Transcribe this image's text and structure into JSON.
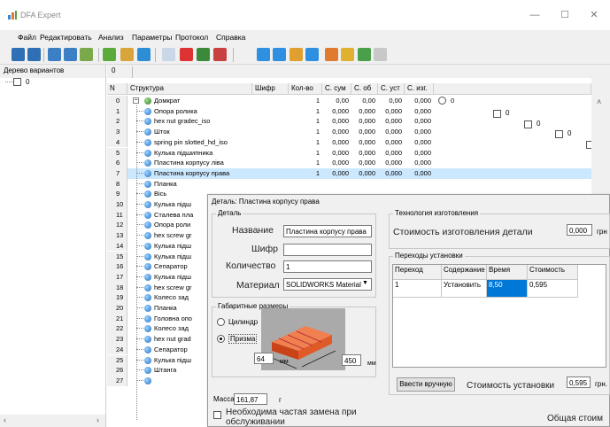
{
  "window": {
    "title": "DFA Expert",
    "controls": {
      "minimize": "—",
      "maximize": "☐",
      "close": "✕"
    }
  },
  "menu": [
    "Файл",
    "Редактировать",
    "Анализ",
    "Параметры",
    "Протокол",
    "Справка"
  ],
  "toolbar": {
    "icons": [
      "open-icon",
      "save-icon",
      "save-as-icon",
      "export-icon",
      "tree-icon",
      "assembly-icon",
      "parts-icon",
      "page-icon",
      "delete-icon",
      "chart-icon",
      "report-icon",
      "add-icon",
      "table-icon",
      "tools-icon",
      "remove-icon",
      "pencil-icon",
      "fill-icon",
      "image-icon",
      "doc-icon"
    ]
  },
  "left_pane": {
    "header": "Дерево вариантов",
    "root_node": "0"
  },
  "grid": {
    "tab": "0",
    "columns": [
      "N",
      "Структура",
      "Шифр",
      "Кол-во",
      "С. сум",
      "С. об",
      "С. уст",
      "С. изг."
    ],
    "root": {
      "n": "0",
      "name": "Домкрат",
      "qty": "1",
      "c_sum": "0,00",
      "c_ob": "0,00",
      "c_ust": "0,00",
      "c_izg": "0,000",
      "option": "0"
    },
    "rows": [
      {
        "n": "1",
        "name": "Опора ролика",
        "qty": "1",
        "c_sum": "0,000",
        "c_ob": "0,000",
        "c_ust": "0,000",
        "c_izg": "0,000"
      },
      {
        "n": "2",
        "name": "hex nut gradec_iso",
        "qty": "1",
        "c_sum": "0,000",
        "c_ob": "0,000",
        "c_ust": "0,000",
        "c_izg": "0,000"
      },
      {
        "n": "3",
        "name": "Шток",
        "qty": "1",
        "c_sum": "0,000",
        "c_ob": "0,000",
        "c_ust": "0,000",
        "c_izg": "0,000"
      },
      {
        "n": "4",
        "name": "spring pin slotted_hd_iso",
        "qty": "1",
        "c_sum": "0,000",
        "c_ob": "0,000",
        "c_ust": "0,000",
        "c_izg": "0,000"
      },
      {
        "n": "5",
        "name": "Кулька підшипника",
        "qty": "1",
        "c_sum": "0,000",
        "c_ob": "0,000",
        "c_ust": "0,000",
        "c_izg": "0,000"
      },
      {
        "n": "6",
        "name": "Пластина корпусу лiва",
        "qty": "1",
        "c_sum": "0,000",
        "c_ob": "0,000",
        "c_ust": "0,000",
        "c_izg": "0,000"
      },
      {
        "n": "7",
        "name": "Пластина корпусу права",
        "qty": "1",
        "c_sum": "0,000",
        "c_ob": "0,000",
        "c_ust": "0,000",
        "c_izg": "0,000"
      },
      {
        "n": "8",
        "name": "Планка"
      },
      {
        "n": "9",
        "name": "Вісь"
      },
      {
        "n": "10",
        "name": "Кулька підш"
      },
      {
        "n": "11",
        "name": "Сталева пла"
      },
      {
        "n": "12",
        "name": "Опора роли"
      },
      {
        "n": "13",
        "name": "hex screw gr"
      },
      {
        "n": "14",
        "name": "Кулька підш"
      },
      {
        "n": "15",
        "name": "Кулька підш"
      },
      {
        "n": "16",
        "name": "Сепаратор"
      },
      {
        "n": "17",
        "name": "Кулька підш"
      },
      {
        "n": "18",
        "name": "hex screw gr"
      },
      {
        "n": "19",
        "name": "Колесо зад"
      },
      {
        "n": "20",
        "name": "Планка"
      },
      {
        "n": "21",
        "name": "Головна опо"
      },
      {
        "n": "22",
        "name": "Колесо зад"
      },
      {
        "n": "23",
        "name": "hex nut grad"
      },
      {
        "n": "24",
        "name": "Сепаратор"
      },
      {
        "n": "25",
        "name": "Кулька підш"
      },
      {
        "n": "26",
        "name": "Штанга"
      },
      {
        "n": "27",
        "name": ""
      }
    ],
    "option_labels": [
      "0",
      "0",
      "0"
    ]
  },
  "dialog": {
    "title": "Деталь: Пластина корпусу права",
    "detail_group": "Деталь",
    "name_label": "Название",
    "name_value": "Пластина корпусу права",
    "code_label": "Шифр",
    "code_value": "",
    "qty_label": "Количество",
    "qty_value": "1",
    "material_label": "Материал",
    "material_value": "SOLIDWORKS Material",
    "dims_group": "Габаритные размеры",
    "cylinder_label": "Цилиндр",
    "prism_label": "Призма",
    "dim1_value": "64",
    "dim1_unit": "мм",
    "dim2_value": "450",
    "dim2_unit": "мм",
    "mass_label": "Масса",
    "mass_value": "161,87",
    "mass_unit": "г",
    "frequent_label_1": "Необходима частая замена при",
    "frequent_label_2": "обслуживании",
    "tech_group": "Технология изготовления",
    "make_cost_label": "Стоимость изготовления детали",
    "make_cost_value": "0,000",
    "make_cost_unit": "грн",
    "ops_group": "Переходы установки",
    "ops_columns": [
      "Переход",
      "Содержание",
      "Время",
      "Стоимость"
    ],
    "ops_rows": [
      {
        "step": "1",
        "content": "Установить",
        "time": "8,50",
        "cost": "0,595"
      }
    ],
    "manual_button": "Ввести вручную",
    "install_cost_label": "Стоимость установки",
    "install_cost_value": "0,595",
    "install_cost_unit": "грн.",
    "total_cost_label": "Общая стоим"
  },
  "colors": {
    "window_bg": "#f0f0f0",
    "selection": "#cce8ff",
    "part_icon": "#1f6fc0",
    "prism_orange": "#e8541e",
    "cell_highlight": "#0078d7"
  }
}
